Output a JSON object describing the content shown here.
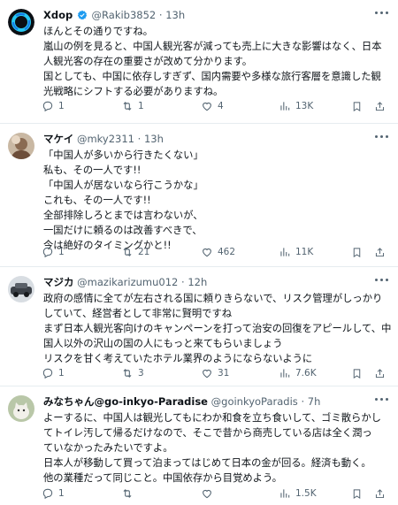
{
  "colors": {
    "text": "#0f1419",
    "secondary": "#536471",
    "verified": "#1d9bf0",
    "divider": "#e6ecf0"
  },
  "posts": [
    {
      "name": "Xdop",
      "verified": true,
      "handle": "@Rakib3852",
      "separator": "·",
      "time": "13h",
      "avatar_icon": "ring-logo-avatar",
      "lines": [
        "ほんとその通りですね。",
        "嵐山の例を見ると、中国人観光客が減っても売上に大きな影響はなく、日本",
        "人観光客の存在の重要さが改めて分かります。",
        "国としても、中国に依存しすぎず、国内需要や多様な旅行客層を意識した観",
        "光戦略にシフトする必要がありますね。"
      ],
      "replies": "1",
      "reposts": "1",
      "likes": "4",
      "views": "13K"
    },
    {
      "name": "マケイ",
      "verified": false,
      "handle": "@mky2311",
      "separator": "·",
      "time": "13h",
      "avatar_icon": "photo-avatar",
      "lines": [
        "「中国人が多いから行きたくない」",
        "私も、その一人です!!",
        "「中国人が居ないなら行こうかな」",
        "これも、その一人です!!",
        "全部排除しろとまでは言わないが、",
        "一国だけに頼るのは改善すべきで、",
        "今は絶好のタイミングかと!!"
      ],
      "replies": "1",
      "reposts": "21",
      "likes": "462",
      "views": "11K"
    },
    {
      "name": "マジカ",
      "verified": false,
      "handle": "@mazikarizumu012",
      "separator": "·",
      "time": "12h",
      "avatar_icon": "car-photo-avatar",
      "lines": [
        "政府の感情に全てが左右される国に頼りきらないで、リスク管理がしっかり",
        "していて、経営者として非常に賢明ですね",
        "まず日本人観光客向けのキャンペーンを打って治安の回復をアピールして、中",
        "国人以外の沢山の国の人にもっと来てもらいましょう",
        "リスクを甘く考えていたホテル業界のようにならないように"
      ],
      "replies": "1",
      "reposts": "3",
      "likes": "31",
      "views": "7.6K"
    },
    {
      "name": "みなちゃん@go-inkyo-Paradise",
      "verified": false,
      "handle": "@goinkyoParadis",
      "separator": "·",
      "time": "7h",
      "avatar_icon": "cat-photo-avatar",
      "lines": [
        "よーするに、中国人は観光してもにわか和食を立ち食いして、ゴミ散らかし",
        "てトイレ汚して帰るだけなので、そこで昔から商売している店は全く潤っ",
        "ていなかったみたいですよ。",
        "日本人が移動して買って泊まってはじめて日本の金が回る。経済も動く。",
        "他の業種だって同じこと。中国依存から目覚めよう。"
      ],
      "replies": "1",
      "reposts": "",
      "likes": "",
      "views": "1.5K"
    }
  ]
}
